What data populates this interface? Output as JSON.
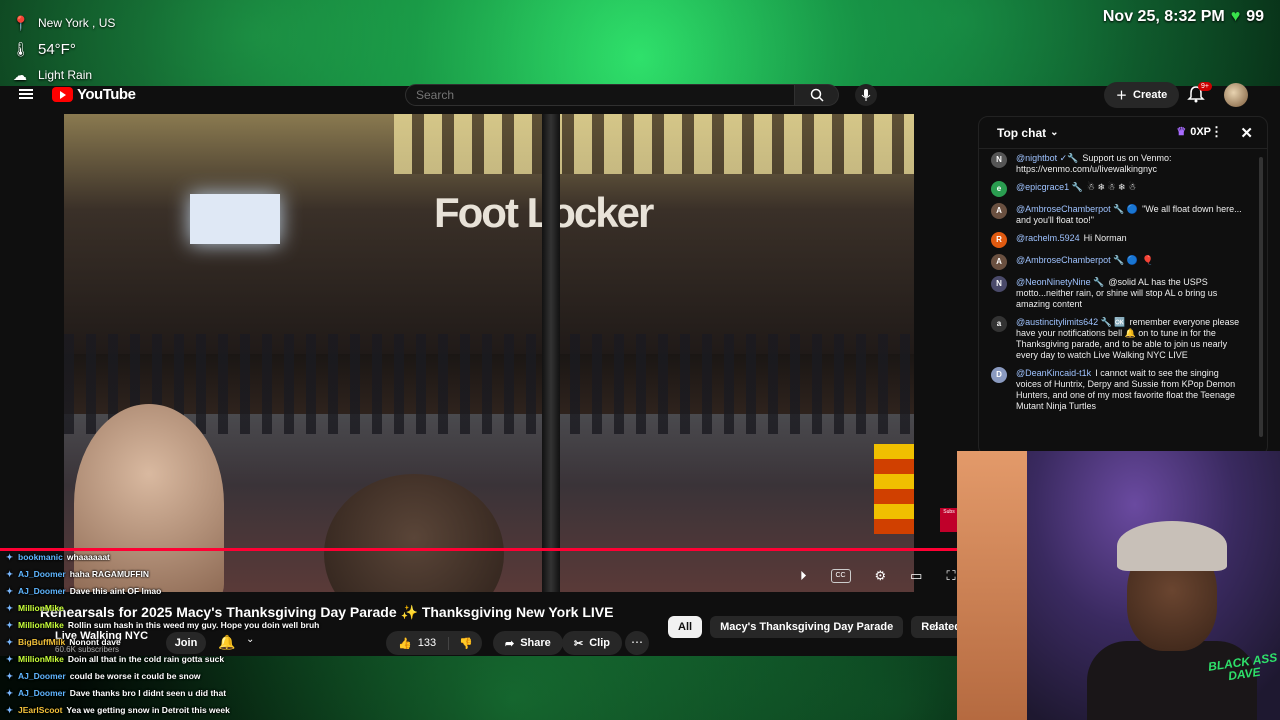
{
  "weather": {
    "location": "New York , US",
    "temperature": "54°F°",
    "condition": "Light Rain"
  },
  "clock": {
    "datetime": "Nov 25, 8:32 PM",
    "counter": "99"
  },
  "youtube": {
    "logo": "YouTube",
    "search_placeholder": "Search",
    "create_label": "Create",
    "notif_badge": "9+"
  },
  "video": {
    "store_sign": "Foot Locker",
    "title": "Rehearsals for 2025 Macy's Thanksgiving Day Parade ✨ Thanksgiving New York LIVE",
    "channel": "Live Walking NYC",
    "subscribers": "60.6K subscribers",
    "join_label": "Join",
    "like_count": "133",
    "share_label": "Share",
    "clip_label": "Clip",
    "overlay_chip": "Subs"
  },
  "related_chips": [
    "All",
    "Macy's Thanksgiving Day Parade",
    "Related"
  ],
  "chat": {
    "header": "Top chat",
    "xp": "0XP",
    "messages": [
      {
        "author": "@nightbot ✓🔧",
        "text": "Support us on Venmo: https://venmo.com/u/livewalkingnyc",
        "avatar": "N",
        "color": "#555"
      },
      {
        "author": "@epicgrace1 🔧",
        "text": "☃ ❄ ☃ ❄ ☃",
        "avatar": "e",
        "color": "#2a9d50"
      },
      {
        "author": "@AmbroseChamberpot 🔧 🔵",
        "text": "\"We all float down here... and you'll float too!\"",
        "avatar": "A",
        "color": "#6a5040"
      },
      {
        "author": "@rachelm.5924",
        "text": "Hi Norman",
        "avatar": "R",
        "color": "#e05a10"
      },
      {
        "author": "@AmbroseChamberpot 🔧 🔵",
        "text": "🎈",
        "avatar": "A",
        "color": "#6a5040"
      },
      {
        "author": "@NeonNinetyNine 🔧",
        "text": "@solid AL has the USPS motto...neither rain, or shine will stop AL o bring us amazing content",
        "avatar": "N",
        "color": "#4a4a6a"
      },
      {
        "author": "@austincitylimits642 🔧 🆗",
        "text": "remember everyone please have your notifications bell 🔔 on to tune in for the Thanksgiving parade, and to be able to join us nearly every day to watch Live Walking NYC LIVE",
        "avatar": "a",
        "color": "#333"
      },
      {
        "author": "@DeanKincaid-t1k",
        "text": "I cannot wait to see the singing voices of Huntrix, Derpy and Sussie from KPop Demon Hunters, and one of my most favorite float the Teenage Mutant Ninja Turtles",
        "avatar": "D",
        "color": "#8a9ac0"
      }
    ]
  },
  "overlay_chat": [
    {
      "user": "bookmanic",
      "text": "whaaaaaat",
      "tone": "b"
    },
    {
      "user": "AJ_Doomer",
      "text": "haha RAGAMUFFIN",
      "tone": "b"
    },
    {
      "user": "AJ_Doomer",
      "text": "Dave this aint OF lmao",
      "tone": "b"
    },
    {
      "user": "MillionMike",
      "text": "",
      "tone": "g"
    },
    {
      "user": "MillionMike",
      "text": "Rollin sum hash in this weed my guy. Hope you doin well bruh",
      "tone": "g"
    },
    {
      "user": "BigBuffMilk",
      "text": "Nonont dave",
      "tone": "o"
    },
    {
      "user": "MillionMike",
      "text": "Doin all that in the cold rain gotta suck",
      "tone": "g"
    },
    {
      "user": "AJ_Doomer",
      "text": "could be worse it could be snow",
      "tone": "b"
    },
    {
      "user": "AJ_Doomer",
      "text": "Dave thanks bro I didnt seen u did that",
      "tone": "b"
    },
    {
      "user": "JEarlScoot",
      "text": "Yea we getting snow in Detroit this week",
      "tone": "o"
    }
  ],
  "cam_logo": "BLACK ASS DAVE"
}
